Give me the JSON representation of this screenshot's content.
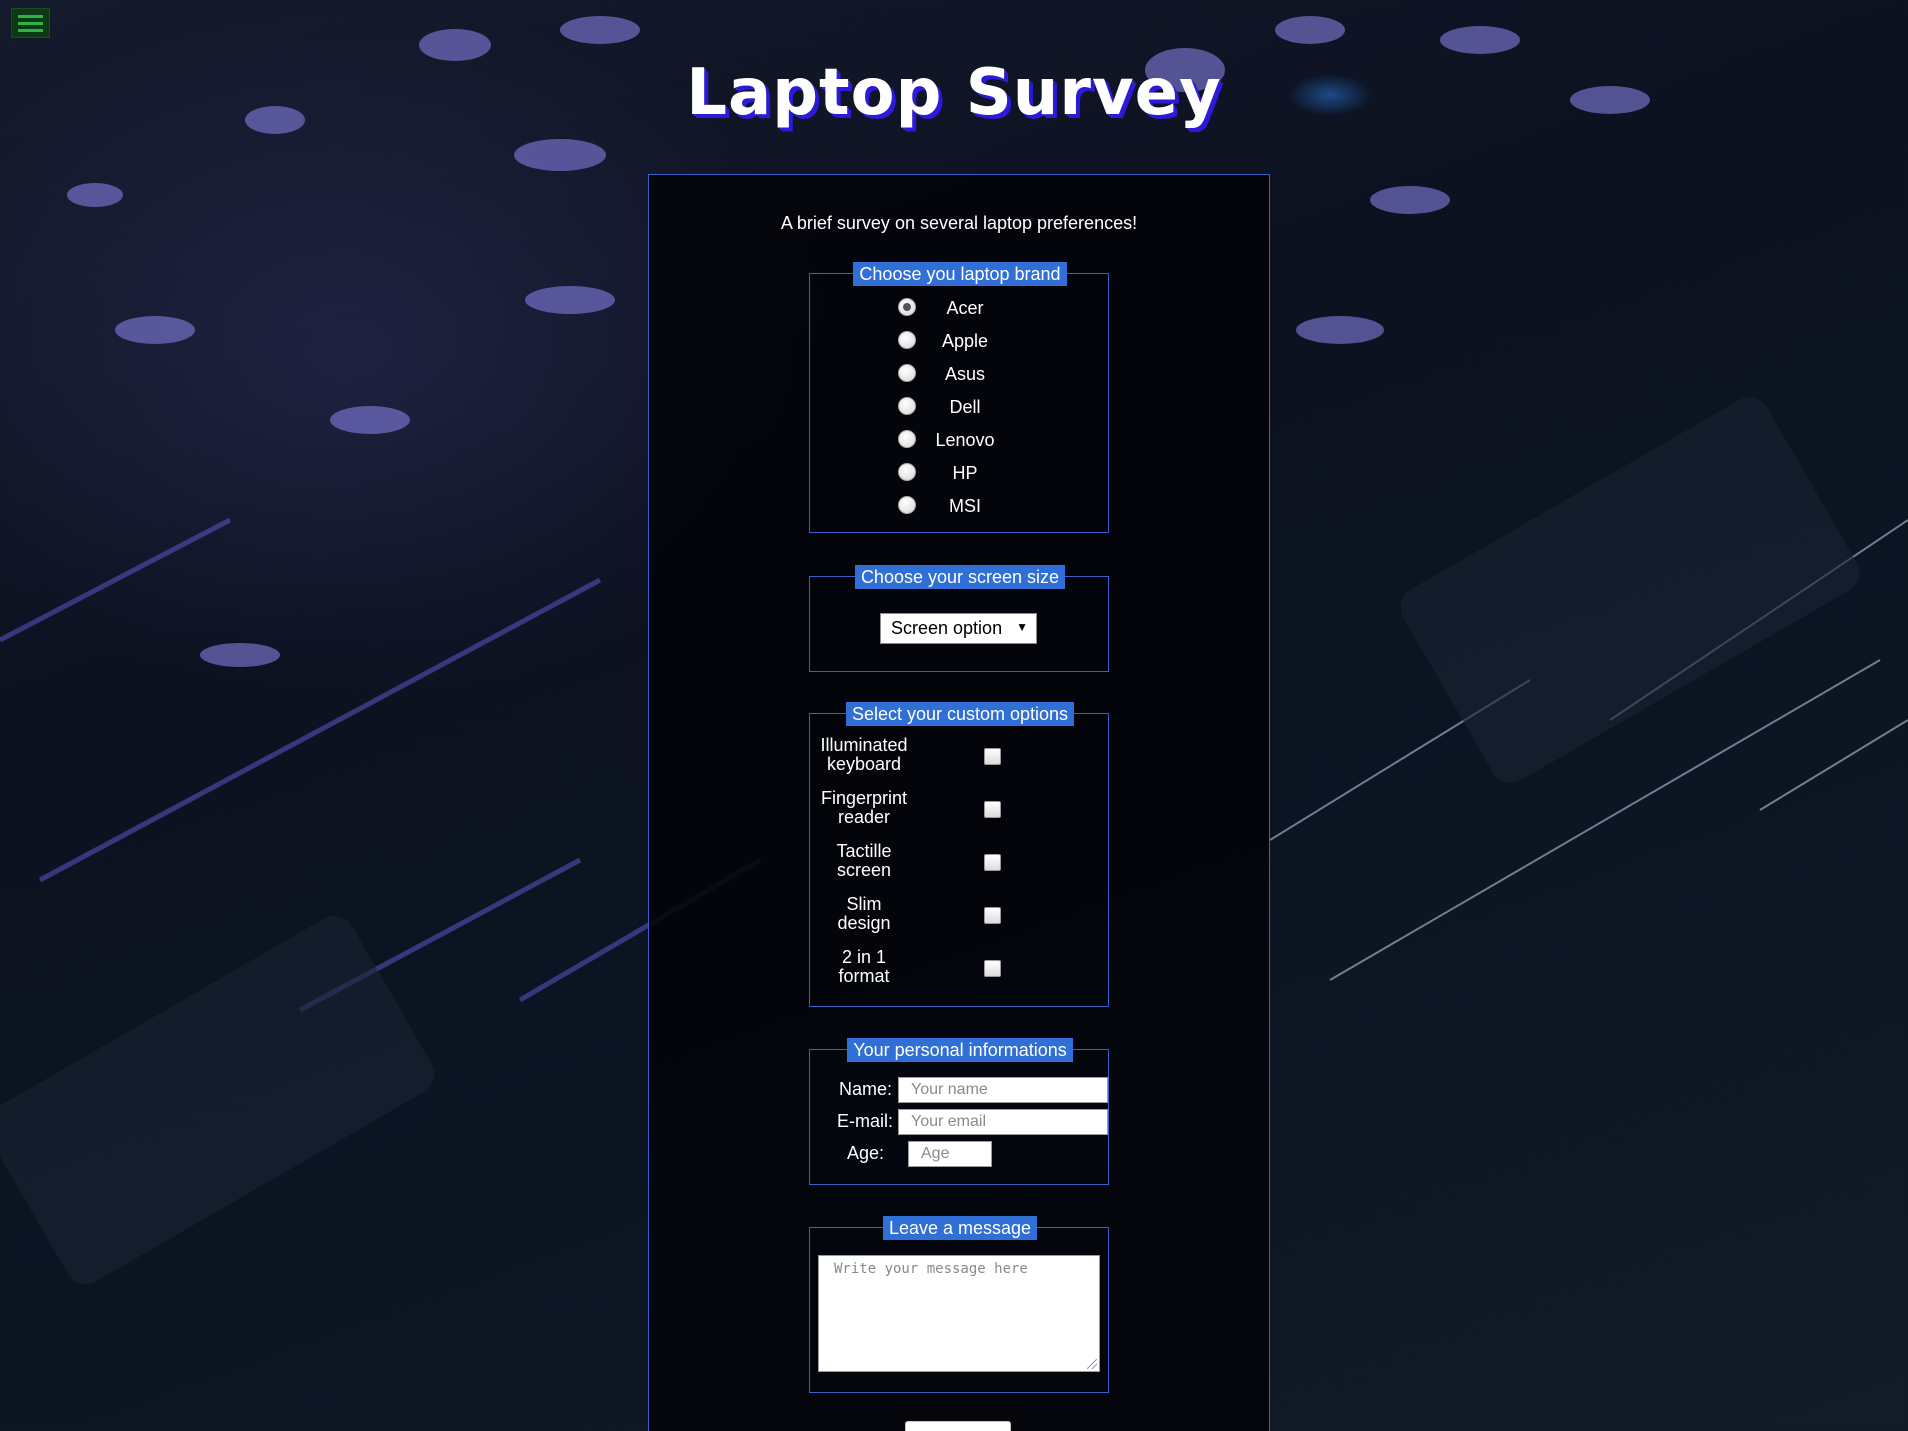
{
  "page": {
    "title": "Laptop Survey",
    "description": "A brief survey on several laptop preferences!"
  },
  "menu": {
    "icon": "hamburger-menu-icon"
  },
  "brand": {
    "legend": "Choose you laptop brand",
    "options": [
      "Acer",
      "Apple",
      "Asus",
      "Dell",
      "Lenovo",
      "HP",
      "MSI"
    ],
    "selected": "Acer"
  },
  "screen": {
    "legend": "Choose your screen size",
    "select_value": "Screen option"
  },
  "custom": {
    "legend": "Select your custom options",
    "options": [
      {
        "line1": "Illuminated",
        "line2": "keyboard"
      },
      {
        "line1": "Fingerprint",
        "line2": "reader"
      },
      {
        "line1": "Tactille",
        "line2": "screen"
      },
      {
        "line1": "Slim",
        "line2": "design"
      },
      {
        "line1": "2 in 1",
        "line2": "format"
      }
    ]
  },
  "personal": {
    "legend": "Your personal informations",
    "name_label": "Name:",
    "name_placeholder": "Your name",
    "email_label": "E-mail:",
    "email_placeholder": "Your email",
    "age_label": "Age:",
    "age_placeholder": "Age"
  },
  "message": {
    "legend": "Leave a message",
    "placeholder": "Write your message here"
  },
  "colors": {
    "accent": "#2f6fd6",
    "border": "#3b5fc6",
    "title_shadow": "#2b1ad9",
    "menu_bg": "#0b3a14",
    "menu_lines": "#2fb24a"
  }
}
